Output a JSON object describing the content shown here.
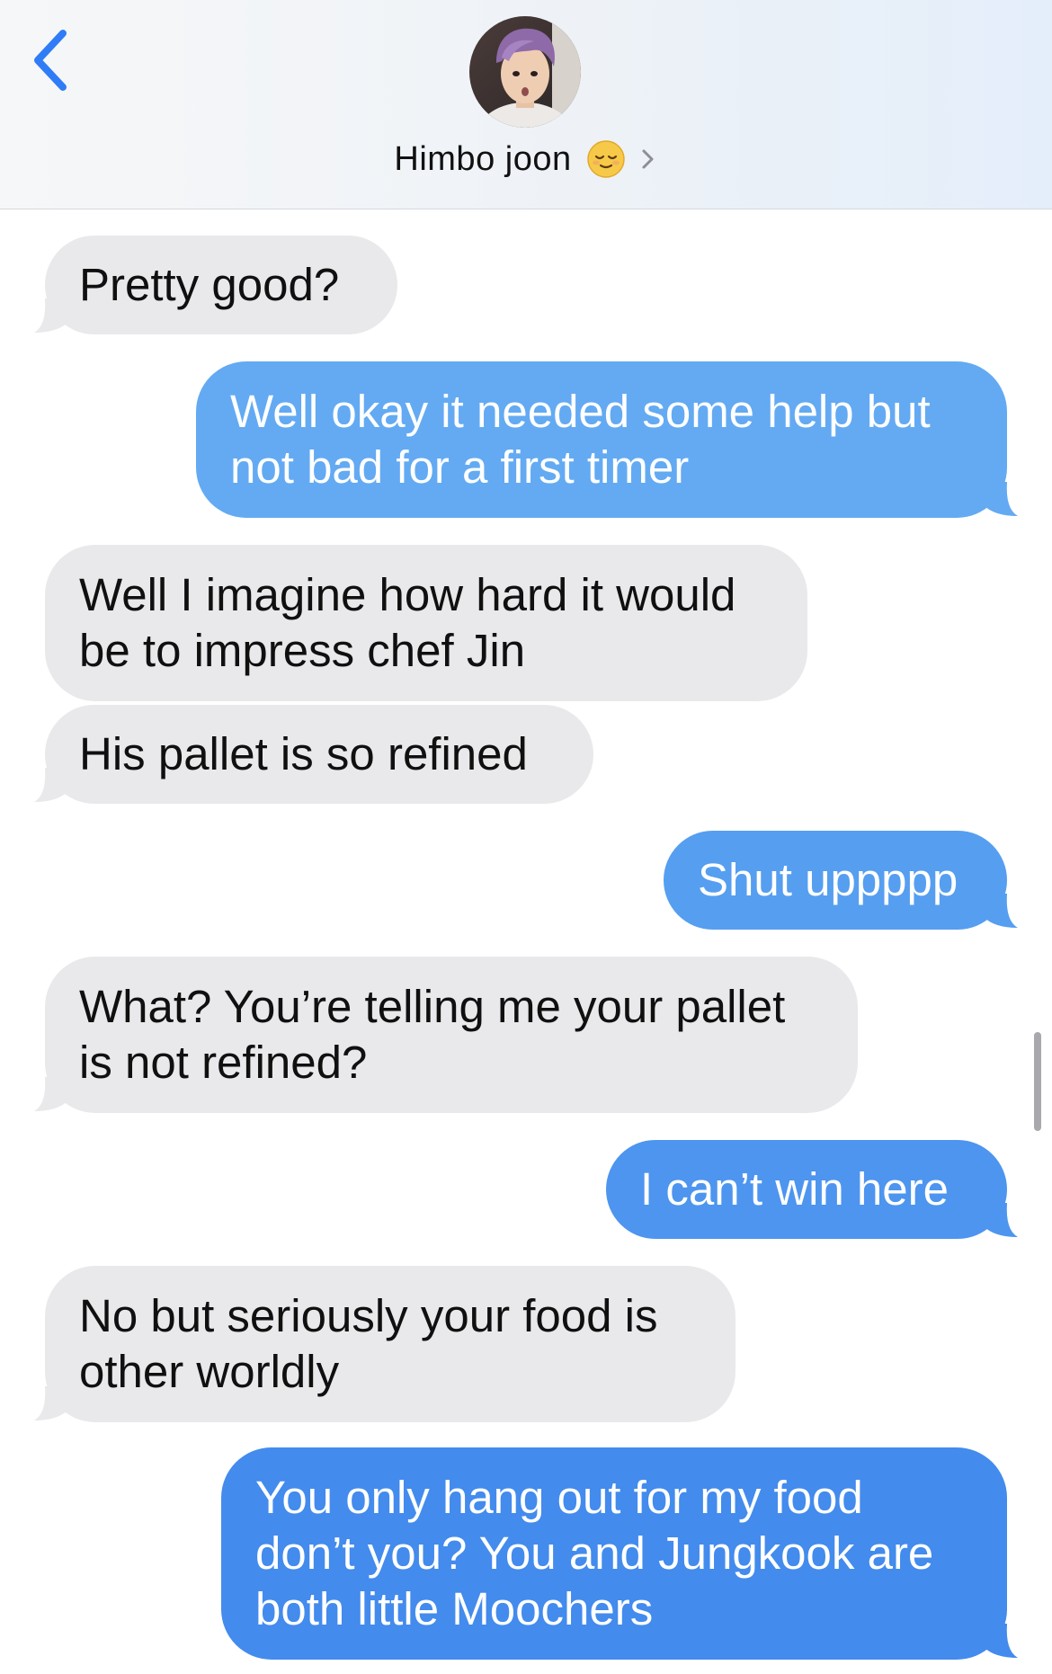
{
  "header": {
    "contact_name": "Himbo joon",
    "contact_emoji": "relieved-face-emoji",
    "back_icon": "chevron-left-icon",
    "chevron_icon": "chevron-right-icon",
    "avatar": "contact-avatar"
  },
  "colors": {
    "header_bg": "#eef2f7",
    "incoming_bubble": "#e9e9eb",
    "outgoing_bubble_top": "#6ab0f4",
    "outgoing_bubble_bottom": "#3f88ec",
    "accent": "#2f7cf6"
  },
  "messages": [
    {
      "from": "contact",
      "lines": [
        "Pretty good?"
      ]
    },
    {
      "from": "me",
      "lines": [
        "Well okay it needed some help but",
        "not bad for a first timer"
      ]
    },
    {
      "from": "contact",
      "lines": [
        "Well I imagine how hard it would",
        "be to impress chef Jin"
      ]
    },
    {
      "from": "contact",
      "lines": [
        "His pallet is so refined"
      ]
    },
    {
      "from": "me",
      "lines": [
        "Shut uppppp"
      ]
    },
    {
      "from": "contact",
      "lines": [
        "What? You’re telling me your pallet",
        "is not refined?"
      ]
    },
    {
      "from": "me",
      "lines": [
        "I can’t win here"
      ]
    },
    {
      "from": "contact",
      "lines": [
        "No but seriously your food is",
        "other worldly"
      ]
    },
    {
      "from": "me",
      "lines": [
        "You only hang out for my food",
        "don’t you? You and Jungkook are",
        "both little Moochers"
      ]
    }
  ]
}
